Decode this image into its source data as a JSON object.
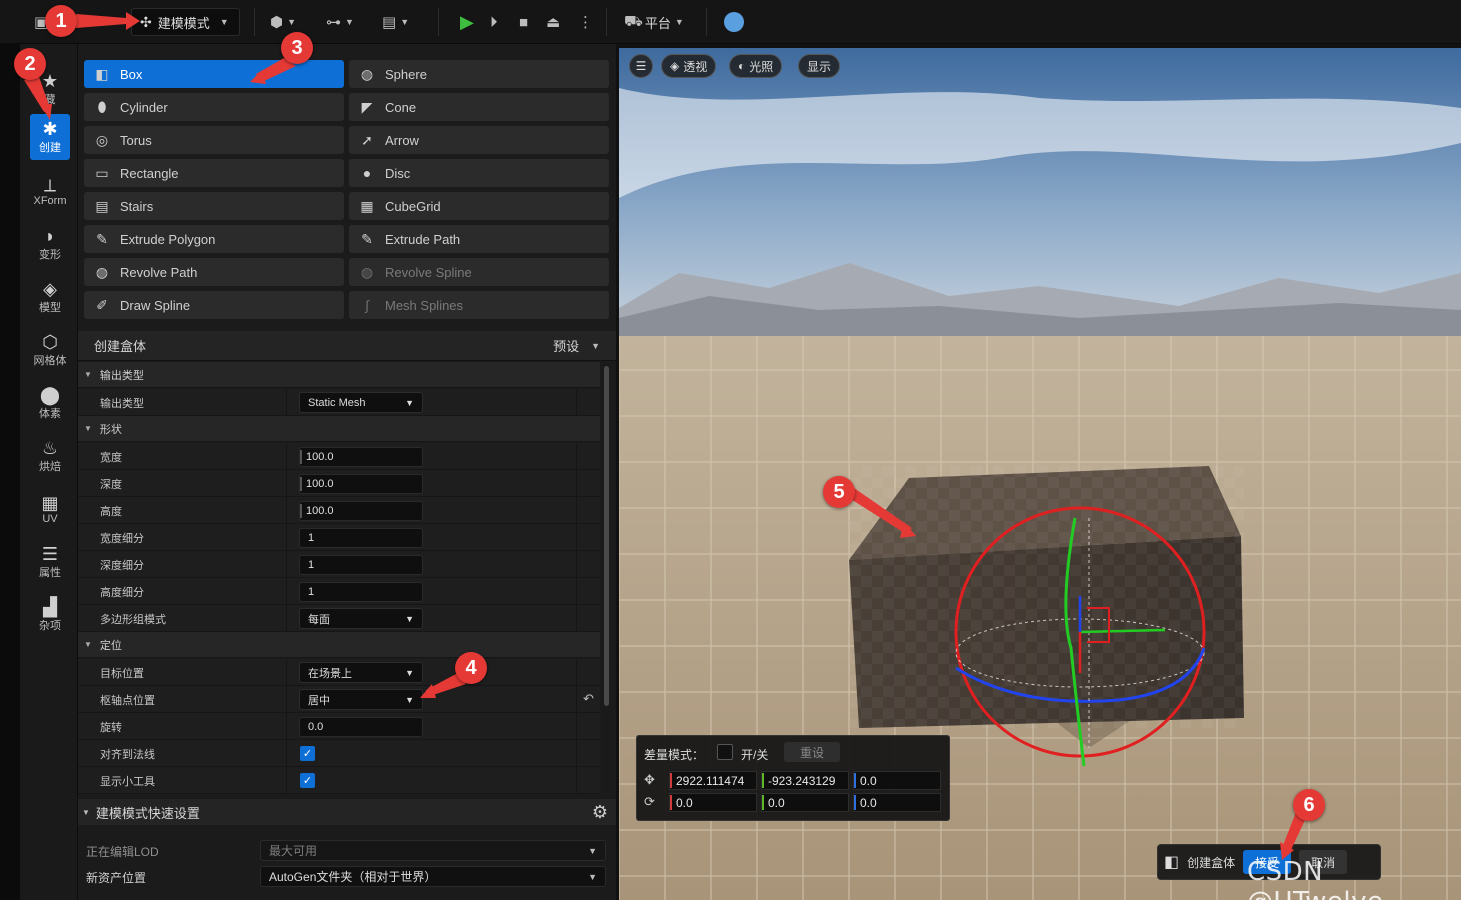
{
  "toolbar": {
    "mode_label": "建模模式",
    "platform_label": "平台"
  },
  "mode_bar": {
    "items": [
      {
        "label": "藏",
        "icon": "star-icon"
      },
      {
        "label": "创建",
        "icon": "create-icon",
        "active": true
      },
      {
        "label": "XForm",
        "icon": "transform-axes-icon"
      },
      {
        "label": "变形",
        "icon": "deform-icon"
      },
      {
        "label": "模型",
        "icon": "model-cube-icon"
      },
      {
        "label": "网格体",
        "icon": "mesh-icon"
      },
      {
        "label": "体素",
        "icon": "voxel-icon"
      },
      {
        "label": "烘焙",
        "icon": "bake-flame-icon"
      },
      {
        "label": "UV",
        "icon": "uv-checker-icon"
      },
      {
        "label": "属性",
        "icon": "attributes-list-icon"
      },
      {
        "label": "杂项",
        "icon": "misc-icon"
      }
    ]
  },
  "tools": {
    "left": [
      {
        "label": "Box",
        "icon": "box-icon",
        "state": "active"
      },
      {
        "label": "Cylinder",
        "icon": "cylinder-icon"
      },
      {
        "label": "Torus",
        "icon": "torus-icon"
      },
      {
        "label": "Rectangle",
        "icon": "rectangle-icon"
      },
      {
        "label": "Stairs",
        "icon": "stairs-icon"
      },
      {
        "label": "Extrude Polygon",
        "icon": "extrude-polygon-icon"
      },
      {
        "label": "Revolve Path",
        "icon": "revolve-path-icon"
      },
      {
        "label": "Draw Spline",
        "icon": "draw-spline-icon"
      }
    ],
    "right": [
      {
        "label": "Sphere",
        "icon": "sphere-icon"
      },
      {
        "label": "Cone",
        "icon": "cone-icon"
      },
      {
        "label": "Arrow",
        "icon": "arrow-icon"
      },
      {
        "label": "Disc",
        "icon": "disc-icon"
      },
      {
        "label": "CubeGrid",
        "icon": "cubegrid-icon"
      },
      {
        "label": "Extrude Path",
        "icon": "extrude-path-icon"
      },
      {
        "label": "Revolve Spline",
        "icon": "revolve-spline-icon",
        "state": "disabled"
      },
      {
        "label": "Mesh Splines",
        "icon": "mesh-splines-icon",
        "state": "disabled"
      }
    ]
  },
  "panel": {
    "title": "创建盒体",
    "preset_label": "预设"
  },
  "props": {
    "sec_output": "输出类型",
    "output_type_label": "输出类型",
    "output_type_value": "Static Mesh",
    "sec_shape": "形状",
    "width_label": "宽度",
    "width_value": "100.0",
    "depth_label": "深度",
    "depth_value": "100.0",
    "height_label": "高度",
    "height_value": "100.0",
    "width_sub_label": "宽度细分",
    "width_sub_value": "1",
    "depth_sub_label": "深度细分",
    "depth_sub_value": "1",
    "height_sub_label": "高度细分",
    "height_sub_value": "1",
    "polygroup_label": "多边形组模式",
    "polygroup_value": "每面",
    "sec_position": "定位",
    "target_label": "目标位置",
    "target_value": "在场景上",
    "pivot_label": "枢轴点位置",
    "pivot_value": "居中",
    "rotation_label": "旋转",
    "rotation_value": "0.0",
    "align_normal_label": "对齐到法线",
    "align_normal_checked": true,
    "show_gizmo_label": "显示小工具",
    "show_gizmo_checked": true
  },
  "quick_settings": {
    "title": "建模模式快速设置",
    "lod_label": "正在编辑LOD",
    "lod_value": "最大可用",
    "asset_label": "新资产位置",
    "asset_value": "AutoGen文件夹（相对于世界）"
  },
  "viewport": {
    "perspective": "透视",
    "lighting": "光照",
    "show": "显示",
    "delta_label": "差量模式：",
    "delta_toggle": "开/关",
    "delta_reset": "重设",
    "loc_x": "2922.111474",
    "loc_y": "-923.243129",
    "loc_z": "0.0",
    "rot_x": "0.0",
    "rot_y": "0.0",
    "rot_z": "0.0",
    "accept_title": "创建盒体",
    "accept_label": "接受",
    "cancel_label": "取消",
    "watermark": "CSDN @UTwelve"
  },
  "annotations": [
    "1",
    "2",
    "3",
    "4",
    "5",
    "6"
  ],
  "colors": {
    "accent": "#0e6fd6",
    "annotation": "#e53935",
    "gizmo_x": "#e02020",
    "gizmo_y": "#22cc22",
    "gizmo_z": "#2244ee"
  }
}
